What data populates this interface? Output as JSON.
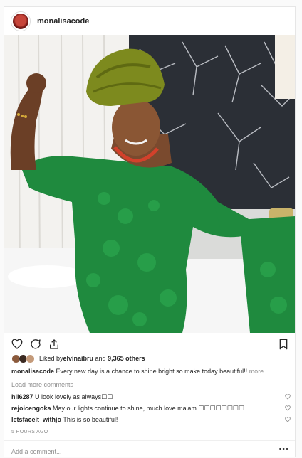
{
  "post": {
    "username": "monalisacode",
    "likes_prefix": "Liked by ",
    "liked_by_user": "elvinaibru",
    "likes_middle": " and ",
    "likes_count": "9,365 others",
    "caption_user": "monalisacode",
    "caption_text": " Every new day is a chance to shine bright so make today beautiful!! ",
    "caption_more": "more",
    "load_more": "Load more comments",
    "comments": [
      {
        "user": "hil6287",
        "text": " U look lovely as always☐☐"
      },
      {
        "user": "rejoicengoka",
        "text": " May our lights continue to shine, much love ma'am ☐☐☐☐☐☐☐☐"
      },
      {
        "user": "letsfaceit_withjo",
        "text": " This is so beautiful!"
      }
    ],
    "timestamp": "5 HOURS AGO",
    "add_comment_placeholder": "Add a comment...",
    "options": "•••"
  },
  "icons": {
    "like": "heart-icon",
    "comment": "comment-icon",
    "share": "share-icon",
    "save": "bookmark-icon",
    "comment_like": "small-heart-icon"
  },
  "colors": {
    "dress": "#1f8a3e",
    "gele": "#7d8a1e",
    "wall": "#2b2f36",
    "muted": "#8e8e8e"
  }
}
